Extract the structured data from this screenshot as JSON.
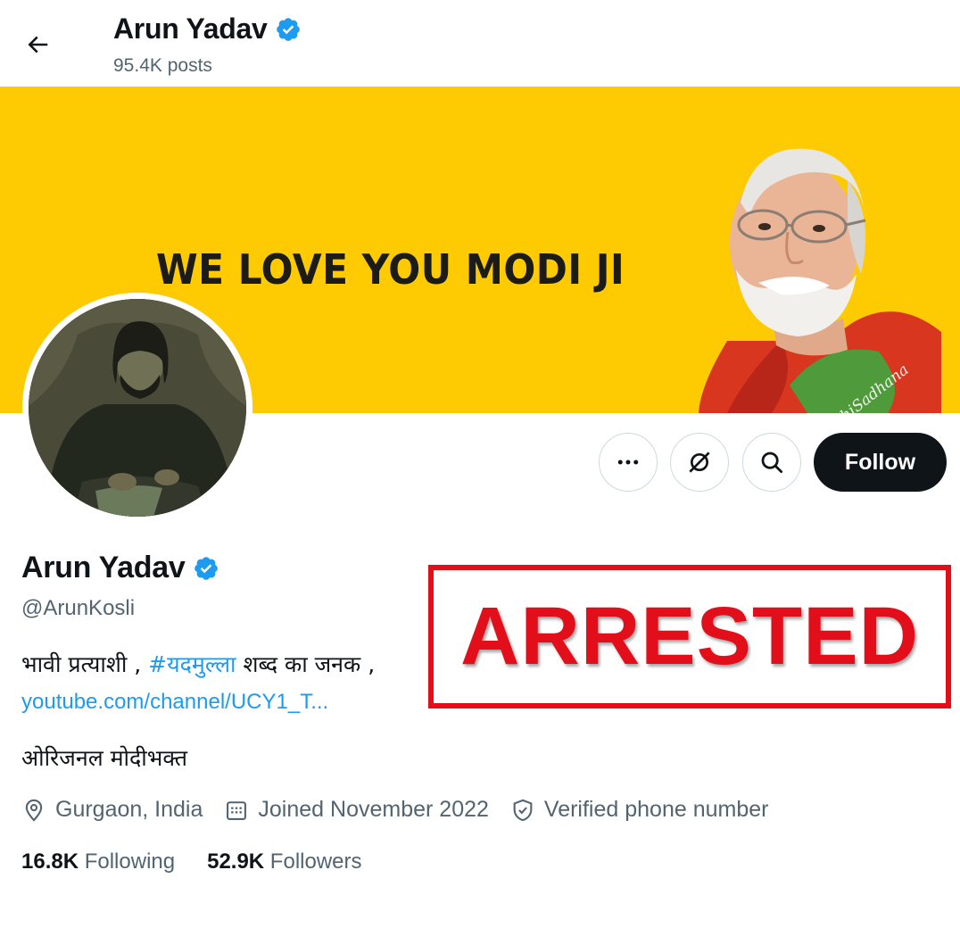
{
  "header": {
    "name": "Arun Yadav",
    "posts": "95.4K posts"
  },
  "banner": {
    "headline": "WE LOVE YOU MODI JI",
    "watermark": "@SacchiSadhana",
    "background_color": "#fecb02"
  },
  "actions": {
    "more_icon": "more-horizontal-icon",
    "grok_icon": "grok-icon",
    "search_icon": "search-icon",
    "follow_label": "Follow"
  },
  "profile": {
    "name": "Arun Yadav",
    "verified_icon": "verified-badge-icon",
    "handle": "@ArunKosli",
    "bio_prefix": "भावी प्रत्याशी , ",
    "bio_hashtag": "#यदमुल्ला",
    "bio_suffix": " शब्द का जनक ,",
    "bio_link": "youtube.com/channel/UCY1_T...",
    "bio_line2": "ओरिजनल मोदीभक्त",
    "location": "Gurgaon, India",
    "joined": "Joined November 2022",
    "verified_phone": "Verified phone number",
    "following_count": "16.8K",
    "following_label": " Following",
    "followers_count": "52.9K",
    "followers_label": " Followers"
  },
  "stamp": {
    "text": "ARRESTED",
    "color": "#e20f1b"
  },
  "colors": {
    "accent": "#1d9bf0",
    "text_primary": "#0f1419",
    "text_secondary": "#536471"
  }
}
